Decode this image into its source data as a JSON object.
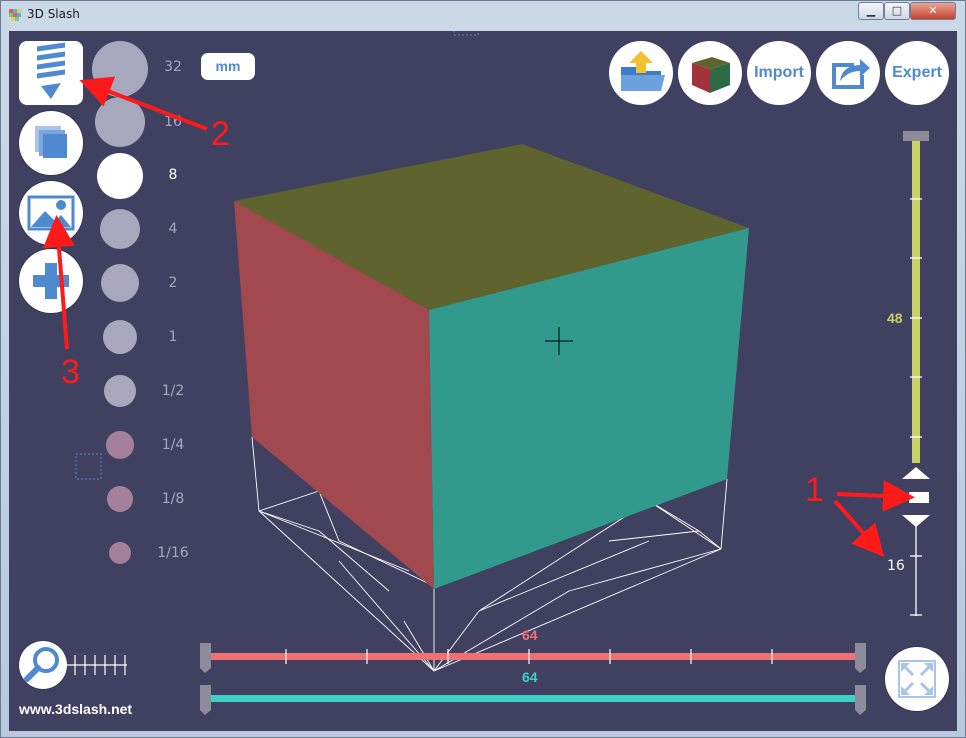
{
  "window": {
    "title": "3D Slash",
    "controls": {
      "minimize": "▁",
      "maximize": "□",
      "close": "✕"
    }
  },
  "toolbar_left": {
    "tools": [
      {
        "name": "chisel-tool",
        "icon": "chisel-icon",
        "selected": true
      },
      {
        "name": "cube-tool",
        "icon": "cube-stack-icon"
      },
      {
        "name": "image-tool",
        "icon": "image-icon"
      },
      {
        "name": "add-tool",
        "icon": "plus-icon"
      }
    ]
  },
  "sizes": {
    "labels": [
      "32",
      "16",
      "8",
      "4",
      "2",
      "1",
      "1/2",
      "1/4",
      "1/8",
      "1/16"
    ],
    "selected": "8"
  },
  "unit_label": "mm",
  "toolbar_top": {
    "open_icon": "folder-upload-icon",
    "color_icon": "color-cube-icon",
    "import_label": "Import",
    "export_icon": "share-icon",
    "expert_label": "Expert"
  },
  "sliders": {
    "vertical_top_value": "48",
    "vertical_bottom_value": "16",
    "red_value": "64",
    "teal_value": "64"
  },
  "colors": {
    "background": "#404061",
    "cube_top": "#5f642f",
    "cube_left": "#a2484f",
    "cube_front": "#329a8c",
    "slider_yellow": "#c8d266",
    "slider_red": "#f07173",
    "slider_teal": "#3fd1c5",
    "annotation": "#ff1a1a"
  },
  "annotations": [
    "1",
    "2",
    "3"
  ],
  "footer": {
    "url": "www.3dslash.net"
  }
}
